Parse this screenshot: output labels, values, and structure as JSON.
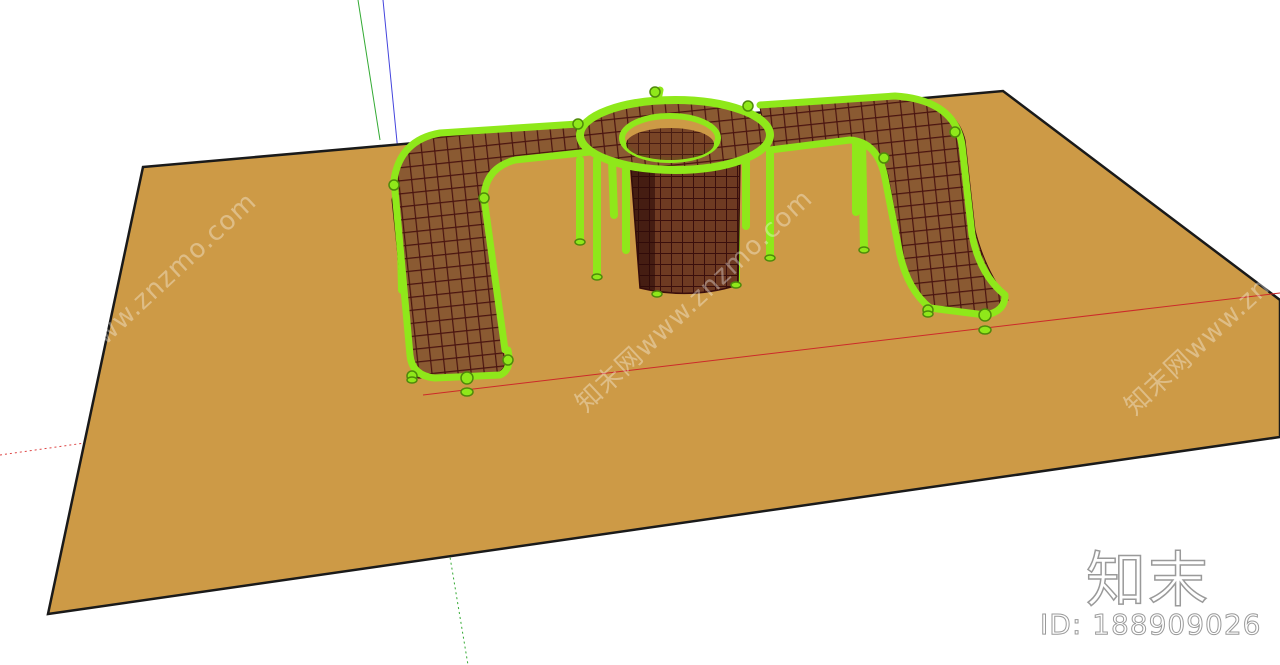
{
  "viewport": {
    "ground_color": "#cd9a46",
    "frame_color": "#8fe81a",
    "net_color": "#5a1a12",
    "axis_colors": {
      "red": "#d44",
      "green": "#3a3",
      "blue": "#44d"
    }
  },
  "watermarks": {
    "left": "知末网www.znzmo.com",
    "center": "知末网www.znzmo.com",
    "right": "知末网www.znzmo.com"
  },
  "brand": {
    "logo": "知末",
    "id_label": "ID: 188909026"
  }
}
